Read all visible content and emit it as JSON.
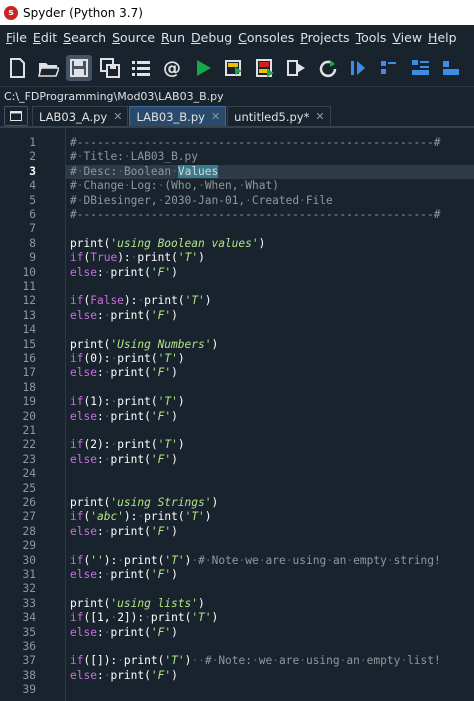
{
  "window": {
    "title": "Spyder (Python 3.7)"
  },
  "menu": [
    "File",
    "Edit",
    "Search",
    "Source",
    "Run",
    "Debug",
    "Consoles",
    "Projects",
    "Tools",
    "View",
    "Help"
  ],
  "toolbar_icons": [
    {
      "name": "new-file-icon"
    },
    {
      "name": "open-folder-icon"
    },
    {
      "name": "save-icon",
      "active": true
    },
    {
      "name": "save-all-icon"
    },
    {
      "name": "list-icon"
    },
    {
      "name": "at-symbol-icon"
    },
    {
      "name": "run-icon"
    },
    {
      "name": "run-cell-icon"
    },
    {
      "name": "run-cell-advance-icon"
    },
    {
      "name": "run-selection-icon"
    },
    {
      "name": "rerun-icon"
    },
    {
      "name": "debug-icon"
    },
    {
      "name": "step-icon"
    },
    {
      "name": "step-into-icon"
    },
    {
      "name": "step-return-icon"
    }
  ],
  "path": "C:\\_FDProgramming\\Mod03\\LAB03_B.py",
  "tabs": [
    {
      "label": "LAB03_A.py",
      "selected": false
    },
    {
      "label": "LAB03_B.py",
      "selected": true
    },
    {
      "label": "untitled5.py*",
      "selected": false
    }
  ],
  "current_line": 3,
  "code_lines": [
    "#-----------------------------------------------------#",
    "# Title: LAB03_B.py",
    "# Desc: Boolean Values",
    "# Change Log: (Who, When, What)",
    "# DBiesinger, 2030-Jan-01, Created File",
    "#-----------------------------------------------------#",
    "",
    "print('using Boolean values')",
    "if(True): print('T')",
    "else: print('F')",
    "",
    "if(False): print('T')",
    "else: print('F')",
    "",
    "print('Using Numbers')",
    "if(0): print('T')",
    "else: print('F')",
    "",
    "if(1): print('T')",
    "else: print('F')",
    "",
    "if(2): print('T')",
    "else: print('F')",
    "",
    "",
    "print('using Strings')",
    "if('abc'): print('T')",
    "else: print('F')",
    "",
    "if(''): print('T') # Note we are using an empty string!",
    "else: print('F')",
    "",
    "print('using lists')",
    "if([1, 2]): print('T')",
    "else: print('F')",
    "",
    "if([]): print('T')  # Note: we are using an empty list!",
    "else: print('F')",
    ""
  ],
  "colors": {
    "background": "#19232d",
    "comment": "#8f979e",
    "keyword": "#c670e0",
    "string": "#b0e686",
    "text": "#ffffff",
    "selection": "#3c7a8a"
  }
}
